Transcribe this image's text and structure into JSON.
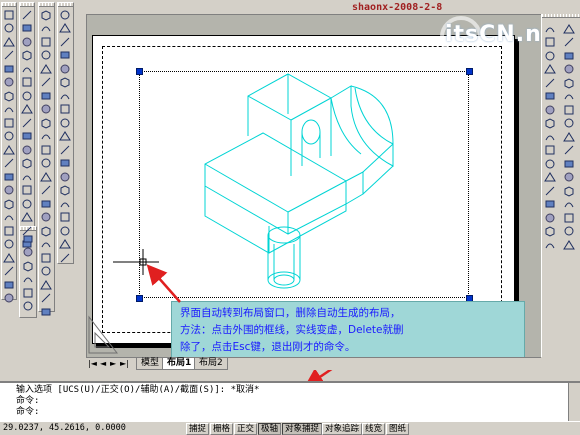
{
  "watermark": {
    "author_date": "shaonx-2008-2-8",
    "site_logo": "itsCN.n"
  },
  "callout": {
    "line1": "界面自动转到布局窗口，删除自动生成的布局，",
    "line2": "方法：点击外围的框线，实线变虚，Delete就删",
    "line3": "除了，点击Esc键，退出刚才的命令。"
  },
  "layout_tabs": {
    "nav": [
      "|◄",
      "◄",
      "►",
      "►|"
    ],
    "items": [
      {
        "label": "模型",
        "active": false
      },
      {
        "label": "布局1",
        "active": true
      },
      {
        "label": "布局2",
        "active": false
      }
    ]
  },
  "command": {
    "line1": "输入选项 [UCS(U)/正交(O)/辅助(A)/截面(S)]: *取消*",
    "line2": "命令:",
    "line3": "命令:"
  },
  "status": {
    "coordinates": "29.0237,  45.2616, 0.0000",
    "buttons": [
      {
        "label": "捕捉",
        "on": false
      },
      {
        "label": "栅格",
        "on": false
      },
      {
        "label": "正交",
        "on": false
      },
      {
        "label": "极轴",
        "on": true
      },
      {
        "label": "对象捕捉",
        "on": true
      },
      {
        "label": "对象追踪",
        "on": false
      },
      {
        "label": "线宽",
        "on": false
      },
      {
        "label": "图纸",
        "on": false
      }
    ]
  },
  "colors": {
    "model_lines": "#00d4d4",
    "grips": "#0033cc",
    "callout_bg": "#9fd7d7",
    "callout_text": "#1a1aff",
    "arrow": "#e02020"
  }
}
